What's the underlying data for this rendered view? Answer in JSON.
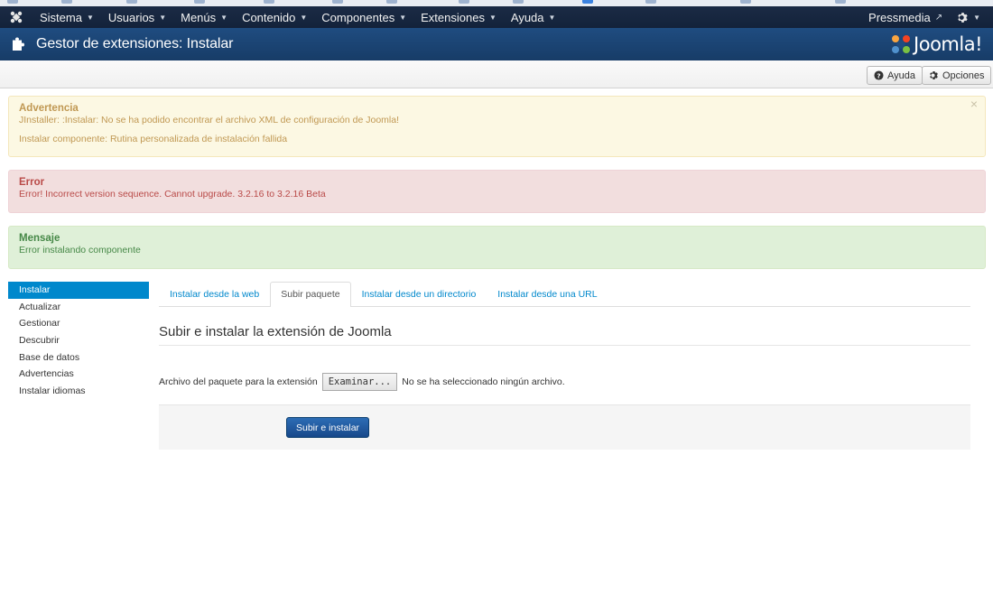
{
  "navbar": {
    "items": [
      {
        "label": "Sistema"
      },
      {
        "label": "Usuarios"
      },
      {
        "label": "Menús"
      },
      {
        "label": "Contenido"
      },
      {
        "label": "Componentes"
      },
      {
        "label": "Extensiones"
      },
      {
        "label": "Ayuda"
      }
    ],
    "site_link": "Pressmedia"
  },
  "header": {
    "title": "Gestor de extensiones: Instalar",
    "brand": "Joomla!"
  },
  "toolbar": {
    "help_label": "Ayuda",
    "options_label": "Opciones"
  },
  "alerts": {
    "warning": {
      "heading": "Advertencia",
      "line1": "JInstaller: :Instalar: No se ha podido encontrar el archivo XML de configuración de Joomla!",
      "line2": "Instalar componente: Rutina personalizada de instalación fallida",
      "close": "×"
    },
    "error": {
      "heading": "Error",
      "line1": "Error! Incorrect version sequence. Cannot upgrade. 3.2.16 to 3.2.16 Beta"
    },
    "message": {
      "heading": "Mensaje",
      "line1": "Error instalando componente"
    }
  },
  "sidebar": {
    "items": [
      {
        "label": "Instalar"
      },
      {
        "label": "Actualizar"
      },
      {
        "label": "Gestionar"
      },
      {
        "label": "Descubrir"
      },
      {
        "label": "Base de datos"
      },
      {
        "label": "Advertencias"
      },
      {
        "label": "Instalar idiomas"
      }
    ]
  },
  "tabs": [
    {
      "label": "Instalar desde la web"
    },
    {
      "label": "Subir paquete"
    },
    {
      "label": "Instalar desde un directorio"
    },
    {
      "label": "Instalar desde una URL"
    }
  ],
  "upload": {
    "section_title": "Subir e instalar la extensión de Joomla",
    "file_label": "Archivo del paquete para la extensión",
    "browse_label": "Examinar...",
    "no_file_text": "No se ha seleccionado ningún archivo.",
    "submit_label": "Subir e instalar"
  },
  "colors": {
    "navbar": "#13223a",
    "header": "#1f4c80",
    "accent": "#0088cc",
    "primary_button": "#1f5aa0"
  }
}
